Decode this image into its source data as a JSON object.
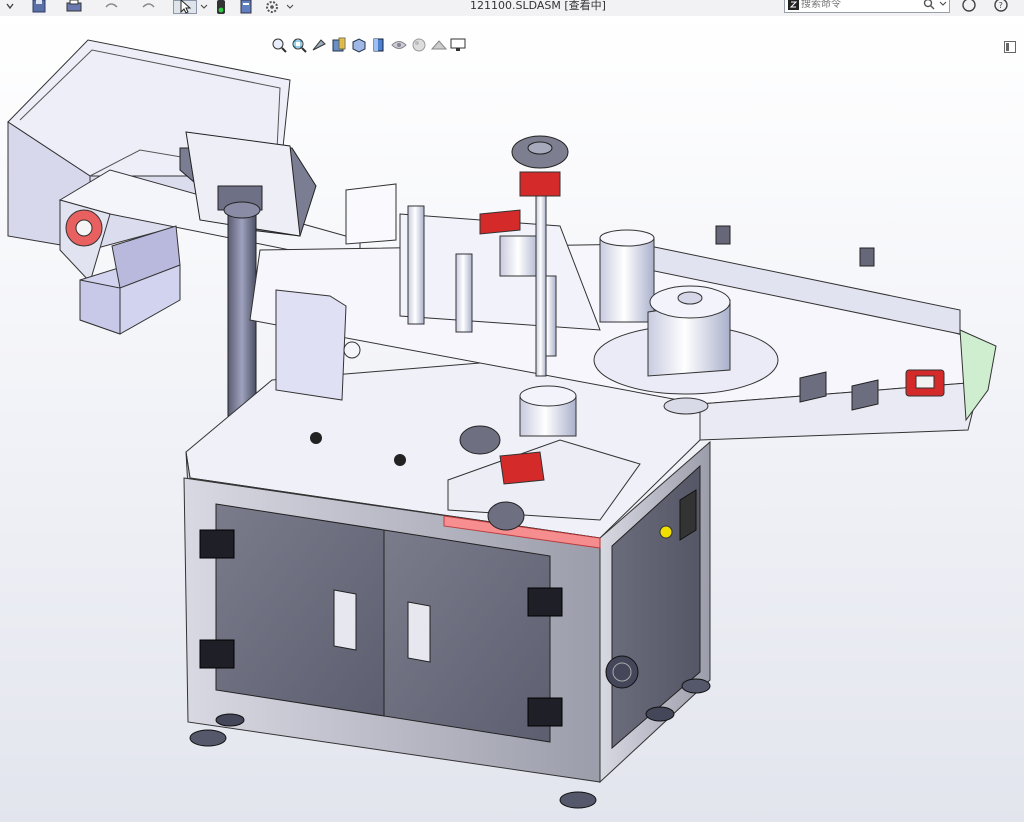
{
  "titlebar": {
    "document_title": "121100.SLDASM [查看中]",
    "search_placeholder": "搜索命令"
  },
  "toolbar": {
    "icons": [
      "new-icon",
      "save-icon",
      "print-icon",
      "undo-icon",
      "redo-icon",
      "select-icon",
      "traffic-light-icon",
      "file-properties-icon",
      "options-icon"
    ]
  },
  "heads_up_toolbar": {
    "icons": [
      "zoom-to-fit-icon",
      "zoom-to-area-icon",
      "previous-view-icon",
      "section-view-icon",
      "view-orientation-icon",
      "display-style-icon",
      "hide-show-icon",
      "edit-appearance-icon",
      "apply-scene-icon",
      "view-settings-icon"
    ]
  },
  "colors": {
    "frame": "#a9aab6",
    "panel": "#6b6e80",
    "sheet": "#eeeef7",
    "accent_red": "#d42a2a",
    "highlight": "#ff8b8b"
  }
}
